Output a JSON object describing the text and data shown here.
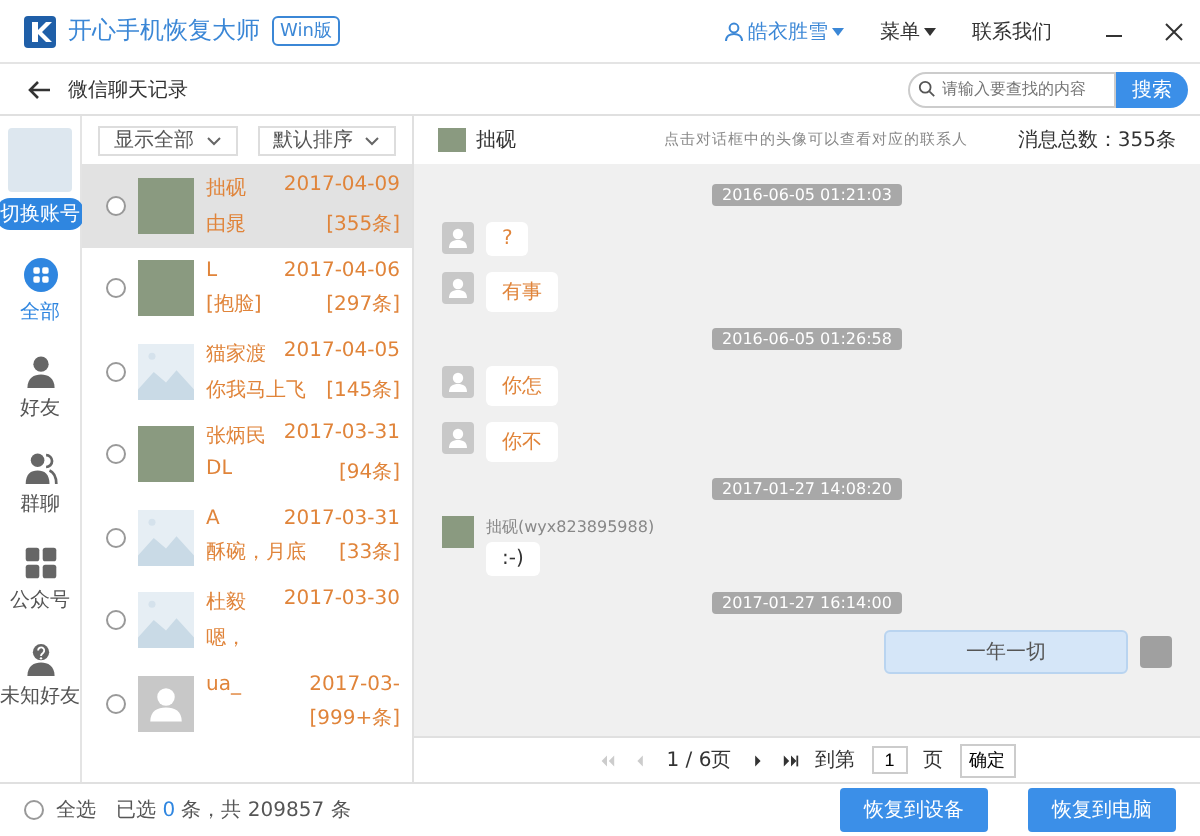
{
  "app": {
    "title": "开心手机恢复大师",
    "edition": "Win版",
    "user": "皓衣胜雪",
    "menu": "菜单",
    "contact": "联系我们"
  },
  "toolbar": {
    "title": "微信聊天记录",
    "search_placeholder": "请输入要查找的内容",
    "search_button": "搜索"
  },
  "account": {
    "switch_button": "切换账号"
  },
  "sidebar": {
    "items": [
      {
        "label": "全部",
        "kind": "all",
        "selected": true
      },
      {
        "label": "好友",
        "kind": "friend",
        "selected": false
      },
      {
        "label": "群聊",
        "kind": "group",
        "selected": false
      },
      {
        "label": "公众号",
        "kind": "official",
        "selected": false
      },
      {
        "label": "未知好友",
        "kind": "unknown",
        "selected": false
      }
    ]
  },
  "filters": [
    {
      "label": "显示全部"
    },
    {
      "label": "默认排序"
    }
  ],
  "conversations": [
    {
      "name": "拙砚",
      "preview": "由晁",
      "date": "2017-04-09",
      "count": "[355条]",
      "kind": "photo",
      "checked": false,
      "selected": true
    },
    {
      "name": "L",
      "preview": "[抱脸]",
      "date": "2017-04-06",
      "count": "[297条]",
      "kind": "photo",
      "checked": false,
      "selected": false
    },
    {
      "name": "猫家渡",
      "preview": "你我马上飞",
      "date": "2017-04-05",
      "count": "[145条]",
      "kind": "image",
      "checked": false,
      "selected": false
    },
    {
      "name": "张炳民",
      "preview": "DL",
      "date": "2017-03-31",
      "count": "[94条]",
      "kind": "photo",
      "checked": false,
      "selected": false
    },
    {
      "name": "A",
      "preview": "酥碗，月底",
      "date": "2017-03-31",
      "count": "[33条]",
      "kind": "image",
      "checked": false,
      "selected": false
    },
    {
      "name": "杜毅",
      "preview": "嗯，",
      "date": "2017-03-30",
      "kind": "image",
      "checked": false,
      "selected": false
    },
    {
      "name": "ua_",
      "date": "2017-03-",
      "count": "[999+条]",
      "kind": "person",
      "checked": false,
      "selected": false
    }
  ],
  "chat": {
    "name": "拙砚",
    "hint": "点击对话框中的头像可以查看对应的联系人",
    "total": "消息总数：355条",
    "messages": [
      {
        "kind": "time",
        "text": "2016-06-05 01:21:03"
      },
      {
        "kind": "incoming",
        "text": "?"
      },
      {
        "kind": "incoming",
        "text": "有事"
      },
      {
        "kind": "time",
        "text": "2016-06-05 01:26:58"
      },
      {
        "kind": "incoming",
        "text": "你怎"
      },
      {
        "kind": "incoming",
        "text": "你不"
      },
      {
        "kind": "time",
        "text": "2017-01-27 14:08:20"
      },
      {
        "kind": "incoming",
        "sender": "拙砚(wyx823895988)",
        "text": ":-)"
      },
      {
        "kind": "time",
        "text": "2017-01-27 16:14:00"
      },
      {
        "kind": "outgoing",
        "text": "一年一切"
      }
    ]
  },
  "pager": {
    "page": "1 / 6页",
    "goto_label": "到第",
    "goto_value": "1",
    "unit": "页",
    "confirm": "确定"
  },
  "footer": {
    "select_all": "全选",
    "select_all_checked": false,
    "summary_prefix": "已选",
    "selected_count": "0",
    "summary_suffix": "条，共 209857 条",
    "buttons": [
      "恢复到设备",
      "恢复到电脑"
    ]
  }
}
